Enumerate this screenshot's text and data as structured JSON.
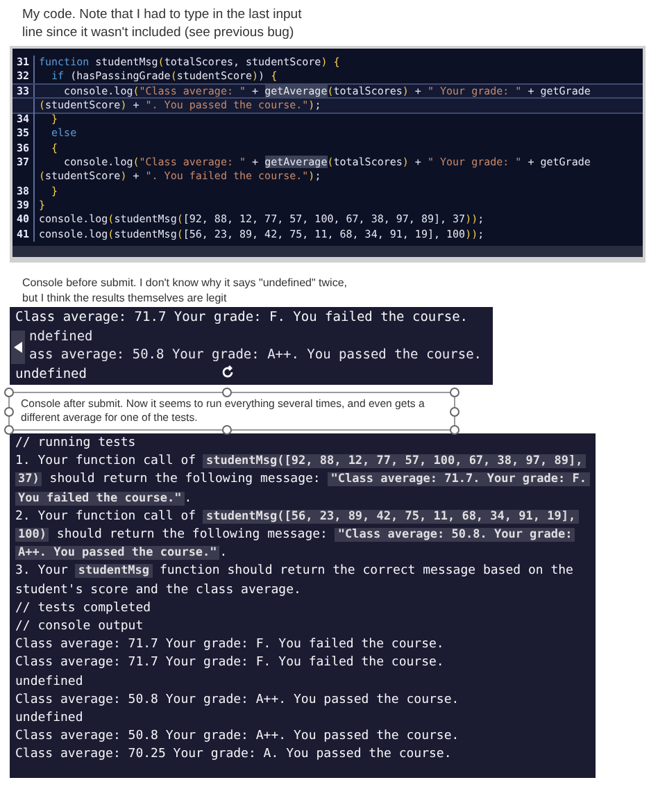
{
  "caption_code": "My code. Note that I had to type in the last input\nline since it wasn't included (see previous bug)",
  "code_editor": {
    "lines": [
      {
        "number": "31",
        "current": false,
        "tokens": [
          {
            "kind": "keyword",
            "text": "function"
          },
          {
            "kind": "plain",
            "text": " studentMsg"
          },
          {
            "kind": "bracket",
            "text": "("
          },
          {
            "kind": "plain",
            "text": "totalScores, studentScore"
          },
          {
            "kind": "bracket",
            "text": ")"
          },
          {
            "kind": "bracket",
            "text": " {"
          }
        ]
      },
      {
        "number": "32",
        "current": false,
        "tokens": [
          {
            "kind": "keyword",
            "text": "  if"
          },
          {
            "kind": "plain",
            "text": " (hasPassingGrade"
          },
          {
            "kind": "bracket",
            "text": "("
          },
          {
            "kind": "plain",
            "text": "studentScore"
          },
          {
            "kind": "bracket",
            "text": ")"
          },
          {
            "kind": "plain",
            "text": ") "
          },
          {
            "kind": "bracket",
            "text": "{"
          }
        ]
      },
      {
        "number": "33",
        "current": true,
        "tokens": [
          {
            "kind": "plain",
            "text": "    console.log"
          },
          {
            "kind": "bracket",
            "text": "("
          },
          {
            "kind": "string",
            "text": "\"Class average: \""
          },
          {
            "kind": "plain",
            "text": " + "
          },
          {
            "kind": "match",
            "text": "getAverage"
          },
          {
            "kind": "bracket",
            "text": "("
          },
          {
            "kind": "plain",
            "text": "totalScores"
          },
          {
            "kind": "bracket",
            "text": ")"
          },
          {
            "kind": "plain",
            "text": " + "
          },
          {
            "kind": "string",
            "text": "\" Your grade: \""
          },
          {
            "kind": "plain",
            "text": " + getGrade"
          }
        ]
      },
      {
        "current": true,
        "tokens": [
          {
            "kind": "bracket",
            "text": "("
          },
          {
            "kind": "plain",
            "text": "studentScore"
          },
          {
            "kind": "bracket",
            "text": ")"
          },
          {
            "kind": "plain",
            "text": " + "
          },
          {
            "kind": "string",
            "text": "\". You passed the course.\""
          },
          {
            "kind": "bracket",
            "text": ")"
          },
          {
            "kind": "plain",
            "text": ";"
          }
        ]
      },
      {
        "number": "34",
        "current": false,
        "tokens": [
          {
            "kind": "bracket",
            "text": "  }"
          }
        ]
      },
      {
        "number": "35",
        "current": false,
        "tokens": [
          {
            "kind": "keyword",
            "text": "  else"
          }
        ]
      },
      {
        "number": "36",
        "current": false,
        "tokens": [
          {
            "kind": "bracket",
            "text": "  {"
          }
        ]
      },
      {
        "number": "37",
        "current": false,
        "tokens": [
          {
            "kind": "plain",
            "text": "    console.log"
          },
          {
            "kind": "bracket",
            "text": "("
          },
          {
            "kind": "string",
            "text": "\"Class average: \""
          },
          {
            "kind": "plain",
            "text": " + "
          },
          {
            "kind": "match",
            "text": "getAverage"
          },
          {
            "kind": "bracket",
            "text": "("
          },
          {
            "kind": "plain",
            "text": "totalScores"
          },
          {
            "kind": "bracket",
            "text": ")"
          },
          {
            "kind": "plain",
            "text": " + "
          },
          {
            "kind": "string",
            "text": "\" Your grade: \""
          },
          {
            "kind": "plain",
            "text": " + getGrade"
          }
        ]
      },
      {
        "current": false,
        "tokens": [
          {
            "kind": "bracket",
            "text": "("
          },
          {
            "kind": "plain",
            "text": "studentScore"
          },
          {
            "kind": "bracket",
            "text": ")"
          },
          {
            "kind": "plain",
            "text": " + "
          },
          {
            "kind": "string",
            "text": "\". You failed the course.\""
          },
          {
            "kind": "bracket",
            "text": ")"
          },
          {
            "kind": "plain",
            "text": ";"
          }
        ]
      },
      {
        "number": "38",
        "current": false,
        "tokens": [
          {
            "kind": "bracket",
            "text": "  }"
          }
        ]
      },
      {
        "number": "39",
        "current": false,
        "tokens": [
          {
            "kind": "bracket",
            "text": "}"
          }
        ]
      },
      {
        "number": "40",
        "current": false,
        "tokens": [
          {
            "kind": "plain",
            "text": "console.log"
          },
          {
            "kind": "bracket",
            "text": "("
          },
          {
            "kind": "plain",
            "text": "studentMsg"
          },
          {
            "kind": "bracket",
            "text": "("
          },
          {
            "kind": "plain",
            "text": "[92, 88, 12, 77, 57, 100, 67, 38, 97, 89], 37"
          },
          {
            "kind": "bracket",
            "text": "))"
          },
          {
            "kind": "plain",
            "text": ";"
          }
        ]
      },
      {
        "number": "41",
        "current": false,
        "tokens": [
          {
            "kind": "plain",
            "text": "console.log"
          },
          {
            "kind": "bracket",
            "text": "("
          },
          {
            "kind": "plain",
            "text": "studentMsg"
          },
          {
            "kind": "bracket",
            "text": "("
          },
          {
            "kind": "plain",
            "text": "[56, 23, 89, 42, 75, 11, 68, 34, 91, 19], 100"
          },
          {
            "kind": "bracket",
            "text": "))"
          },
          {
            "kind": "plain",
            "text": ";"
          }
        ]
      }
    ]
  },
  "caption_before": "Console before submit. I don't know why it says \"undefined\" twice,\nbut I think the results themselves are legit",
  "console_before": {
    "lines": [
      {
        "text": "Class average: 71.7 Your grade: F. You failed the course.",
        "covered": false
      },
      {
        "text": "ndefined",
        "covered": true
      },
      {
        "text": "ass average: 50.8 Your grade: A++. You passed the course.",
        "covered": true
      },
      {
        "text": "undefined",
        "covered": false
      }
    ]
  },
  "caption_after": {
    "text": "Console after submit. Now it seems to run everything several times, and even gets a\ndifferent average for one of the tests.",
    "selected": true
  },
  "console_after": {
    "lines": [
      [
        {
          "kind": "text",
          "text": "// running tests"
        }
      ],
      [
        {
          "kind": "text",
          "text": "1. Your function call of "
        },
        {
          "kind": "code",
          "text": "studentMsg([92, 88, 12, 77, 57, 100, 67, 38, 97, 89], 37)"
        },
        {
          "kind": "text",
          "text": " should return the following message: "
        },
        {
          "kind": "code",
          "text": "\"Class average: 71.7. Your grade: F. You failed the course.\""
        },
        {
          "kind": "text",
          "text": "."
        }
      ],
      [
        {
          "kind": "text",
          "text": "2. Your function call of "
        },
        {
          "kind": "code",
          "text": "studentMsg([56, 23, 89, 42, 75, 11, 68, 34, 91, 19], 100)"
        },
        {
          "kind": "text",
          "text": " should return the following message: "
        },
        {
          "kind": "code",
          "text": "\"Class average: 50.8. Your grade: A++. You passed the course.\""
        },
        {
          "kind": "text",
          "text": "."
        }
      ],
      [
        {
          "kind": "text",
          "text": "3. Your "
        },
        {
          "kind": "code",
          "text": "studentMsg"
        },
        {
          "kind": "text",
          "text": " function should return the correct message based on the student's score and the class average."
        }
      ],
      [
        {
          "kind": "text",
          "text": "// tests completed"
        }
      ],
      [
        {
          "kind": "text",
          "text": "// console output"
        }
      ],
      [
        {
          "kind": "text",
          "text": "Class average: 71.7 Your grade: F. You failed the course."
        }
      ],
      [
        {
          "kind": "text",
          "text": "Class average: 71.7 Your grade: F. You failed the course."
        }
      ],
      [
        {
          "kind": "text",
          "text": "undefined"
        }
      ],
      [
        {
          "kind": "text",
          "text": "Class average: 50.8 Your grade: A++. You passed the course."
        }
      ],
      [
        {
          "kind": "text",
          "text": "undefined"
        }
      ],
      [
        {
          "kind": "text",
          "text": "Class average: 50.8 Your grade: A++. You passed the course."
        }
      ],
      [
        {
          "kind": "text",
          "text": "Class average: 70.25 Your grade: A. You passed the course."
        }
      ]
    ]
  }
}
